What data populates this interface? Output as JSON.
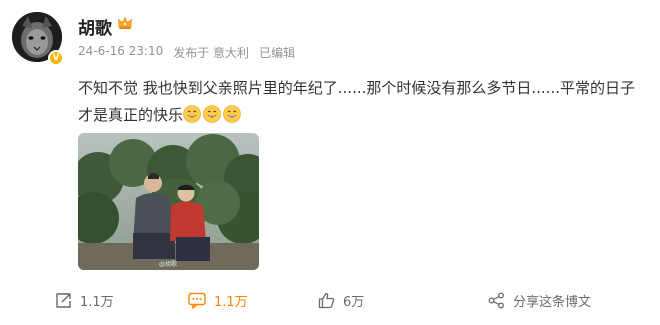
{
  "author": {
    "name": "胡歌",
    "verified_badge": "V",
    "crown_icon": "crown-icon"
  },
  "meta": {
    "timestamp": "24-6-16 23:10",
    "location": "发布于 意大利",
    "edited": "已编辑"
  },
  "post": {
    "text": "不知不觉 我也快到父亲照片里的年纪了......那个时候没有那么多节日......平常的日子才是真正的快乐",
    "emoji_icons": [
      "grin-emoji-icon",
      "grin-emoji-icon",
      "grin-emoji-icon"
    ]
  },
  "photo": {
    "watermark": "@胡歌"
  },
  "actions": {
    "repost": "1.1万",
    "comment": "1.1万",
    "like": "6万",
    "share": "分享这条博文"
  },
  "colors": {
    "accent": "#ff8200",
    "meta_gray": "#939393",
    "text": "#333333",
    "badge": "#f7b500"
  }
}
